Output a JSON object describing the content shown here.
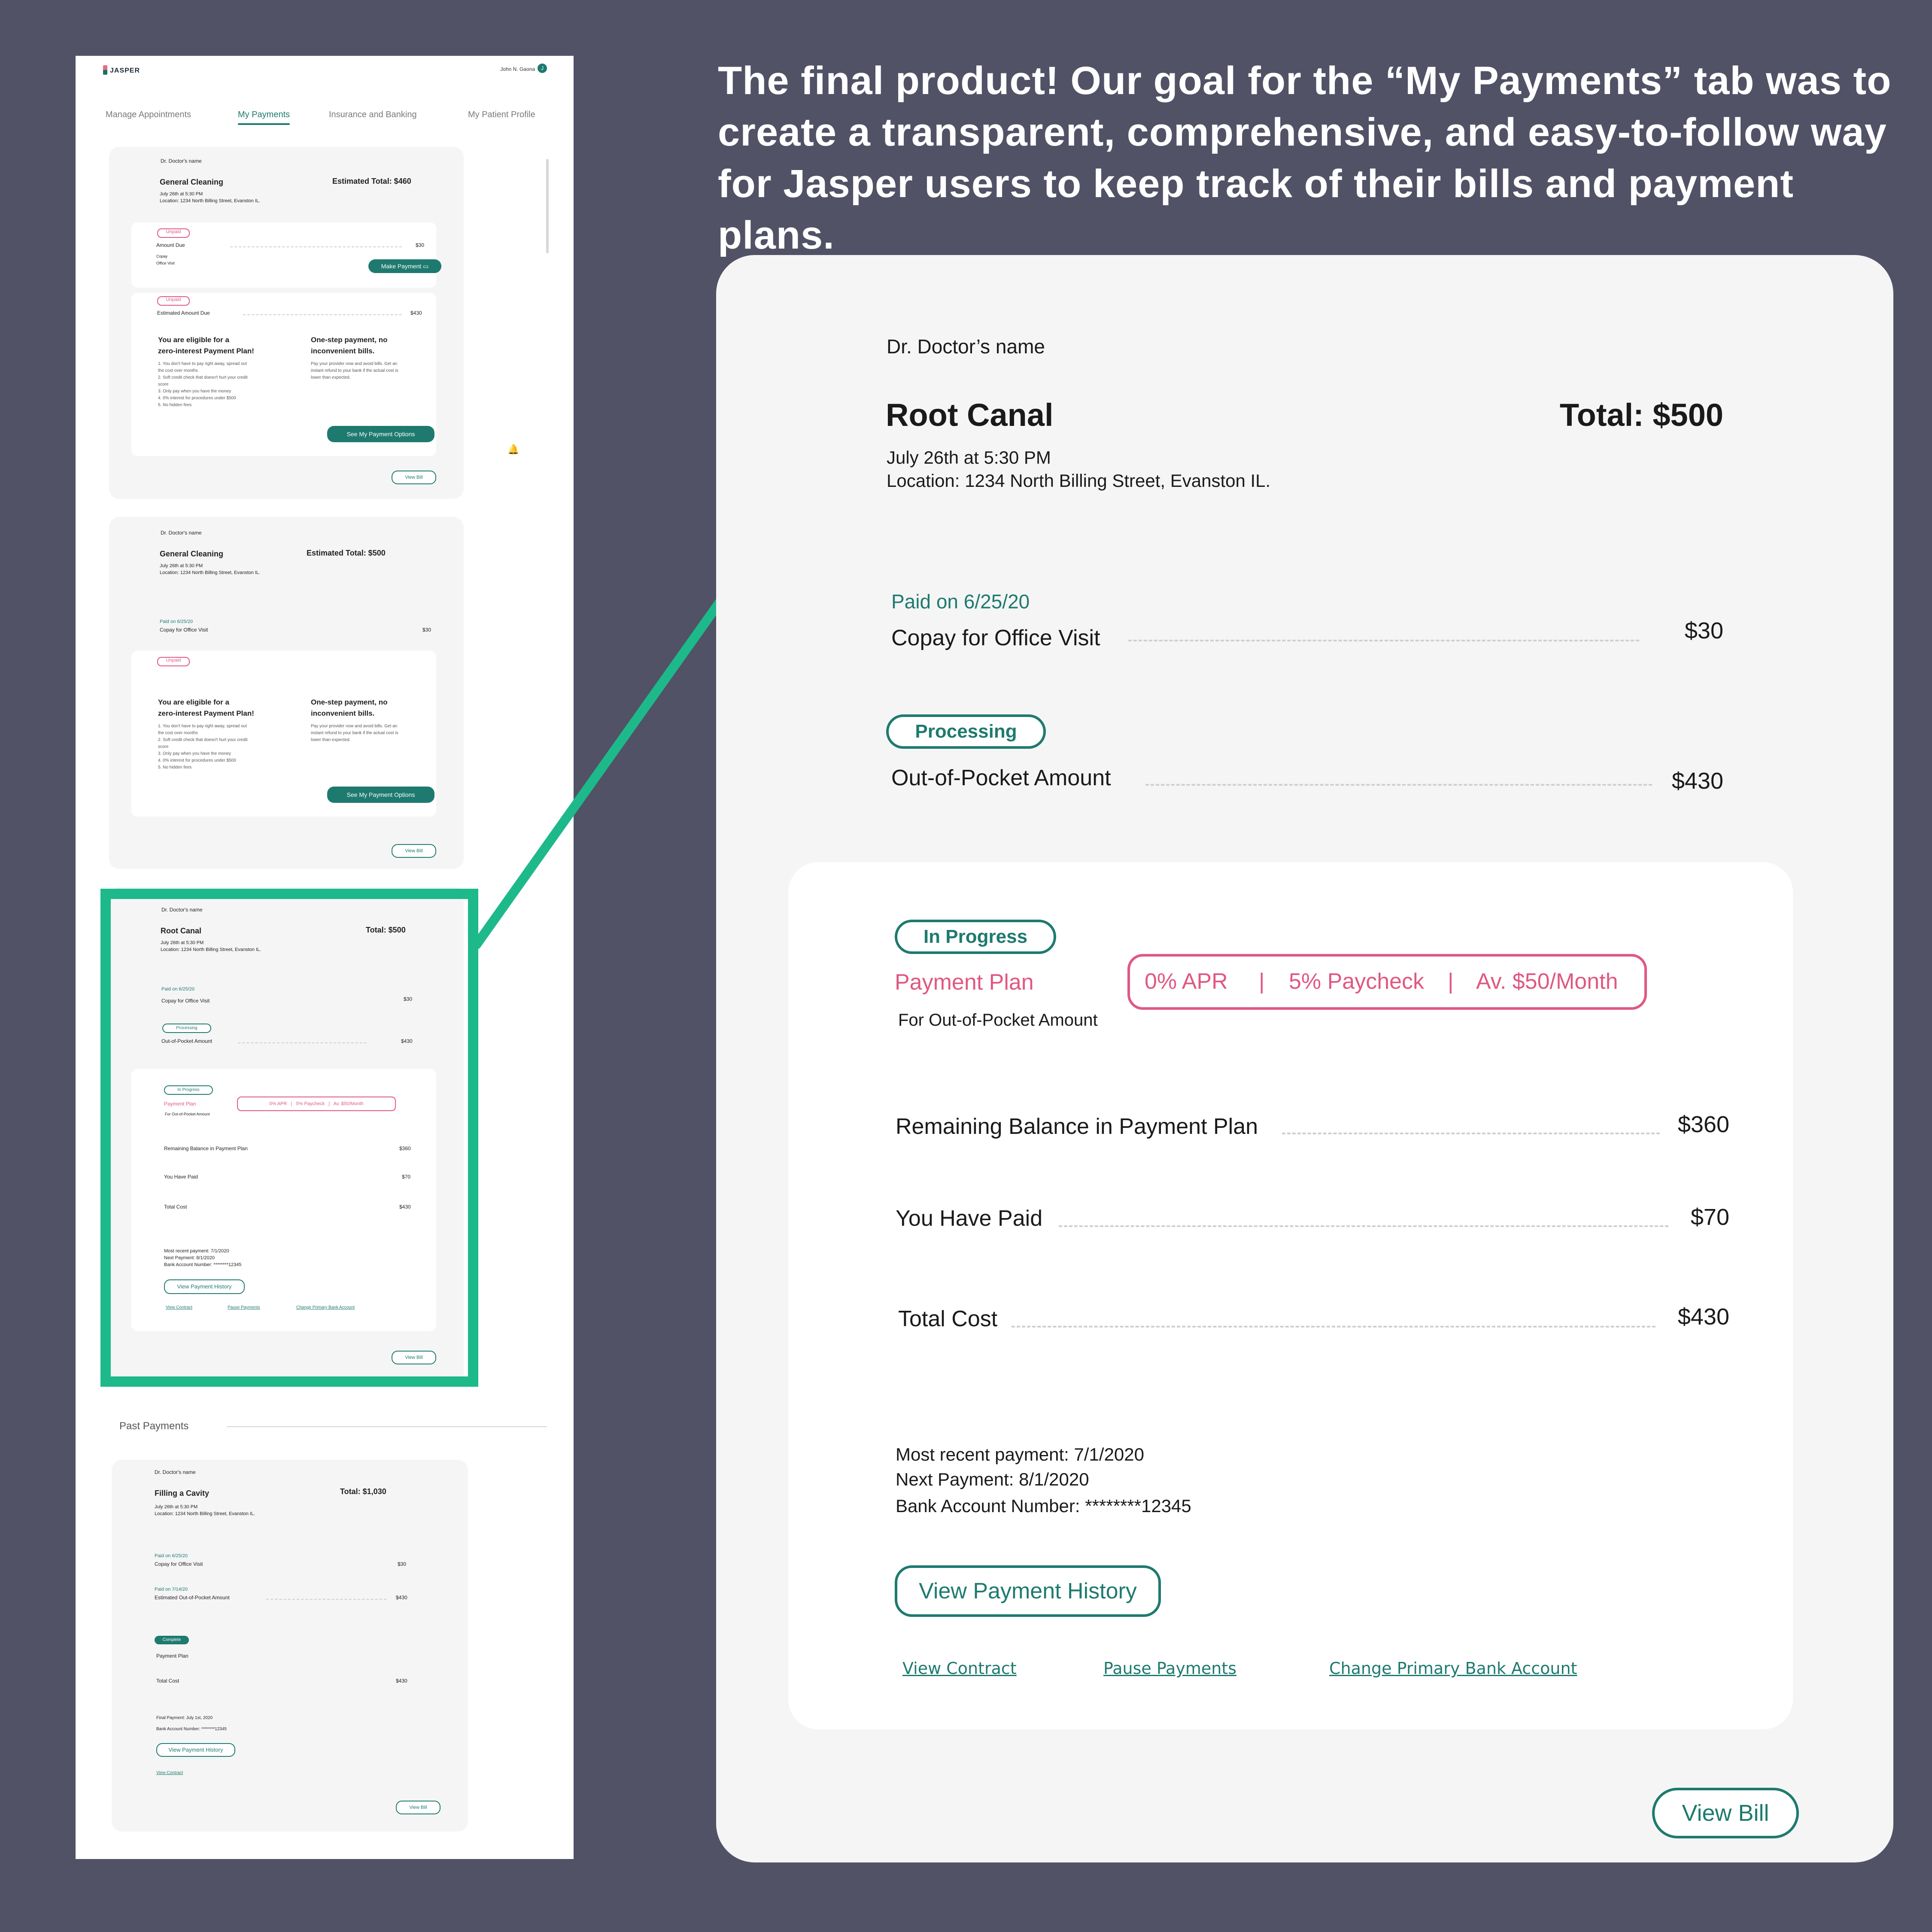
{
  "app": {
    "logo": "JASPER",
    "user_name": "John N. Gaona",
    "user_badge": "J",
    "tabs": [
      {
        "label": "Manage Appointments",
        "active": false
      },
      {
        "label": "My Payments",
        "active": true
      },
      {
        "label": "Insurance and Banking",
        "active": false
      },
      {
        "label": "My Patient Profile",
        "active": false
      }
    ]
  },
  "colors": {
    "background": "#515266",
    "brand_teal": "#1e7a6f",
    "highlight_green": "#1db98b",
    "pink": "#e05882",
    "card": "#f5f5f5"
  },
  "mini_cards": [
    {
      "doctor": "Dr. Doctor's name",
      "procedure": "General Cleaning",
      "total": "Estimated Total: $460",
      "date": "July 26th at 5:30 PM",
      "location": "Location: 1234 North Billing Street, Evanston IL.",
      "amount_due_status": "Unpaid",
      "amount_due_label": "Amount Due",
      "amount_due_value": "$30",
      "amount_due_sub1": "Copay",
      "amount_due_sub2": "Office Visit",
      "make_payment": "Make Payment",
      "est_status": "Unpaid",
      "est_label": "Estimated Amount Due",
      "est_value": "$430",
      "eligible_title_1": "You are eligible for a",
      "eligible_title_2": "zero-interest Payment Plan!",
      "eligible_points": [
        "1. You don't have to pay right away, spread out",
        "the cost over months",
        "2. Soft credit check that doesn't hurt your credit",
        "score",
        "3. Only pay when you have the money",
        "4. 0% interest for procedures under $500",
        "5. No hidden fees"
      ],
      "onestep_title_1": "One-step payment, no",
      "onestep_title_2": "inconvenient bills.",
      "onestep_body": [
        "Pay your provider now and avoid bills. Get an",
        "instant refund to your bank if the actual cost is",
        "lower than expected."
      ],
      "options_button": "See My Payment Options",
      "view_bill": "View Bill"
    },
    {
      "doctor": "Dr. Doctor's name",
      "procedure": "General Cleaning",
      "total": "Estimated Total: $500",
      "date": "July 26th at 5:30 PM",
      "location": "Location: 1234 North Billing Street, Evanston IL.",
      "paid_on": "Paid on 6/25/20",
      "copay_label": "Copay for Office Visit",
      "copay_value": "$30",
      "est_status": "Unpaid",
      "options_button": "See My Payment Options",
      "view_bill": "View Bill"
    },
    {
      "doctor": "Dr. Doctor's name",
      "procedure": "Root Canal",
      "total": "Total: $500",
      "date": "July 26th at 5:30 PM",
      "location": "Location: 1234 North Billing Street, Evanston IL.",
      "paid_on": "Paid on 6/25/20",
      "copay_label": "Copay for Office Visit",
      "copay_value": "$30",
      "processing": "Processing",
      "oop_label": "Out-of-Pocket Amount",
      "oop_value": "$430",
      "in_progress": "In Progress",
      "plan_label": "Payment Plan",
      "plan_terms": "0% APR   |   5% Paycheck   |   Av. $50/Month",
      "plan_for": "For Out-of-Pocket Amount",
      "remaining_label": "Remaining Balance in Payment Plan",
      "remaining_value": "$360",
      "paid_label": "You Have Paid",
      "paid_value": "$70",
      "cost_label": "Total Cost",
      "cost_value": "$430",
      "recent": "Most recent payment: 7/1/2020",
      "next": "Next Payment: 8/1/2020",
      "bank": "Bank Account Number: ********12345",
      "history": "View Payment History",
      "link1": "View Contract",
      "link2": "Pause Payments",
      "link3": "Change Primary Bank Account",
      "view_bill": "View Bill"
    }
  ],
  "past_payments": {
    "heading": "Past Payments",
    "doctor": "Dr. Doctor's name",
    "procedure": "Filling a Cavity",
    "total": "Total: $1,030",
    "date": "July 26th at 5:30 PM",
    "location": "Location: 1234 North Billing Street, Evanston IL.",
    "paid_on_1": "Paid on 6/25/20",
    "copay_label": "Copay for Office Visit",
    "copay_value": "$30",
    "paid_on_2": "Paid on 7/14/20",
    "est_label": "Estimated Out-of-Pocket Amount",
    "est_value": "$430",
    "complete": "Complete",
    "plan_label": "Payment Plan",
    "cost_label": "Total Cost",
    "cost_value": "$430",
    "final_payment": "Final Payment: July 1st, 2020",
    "bank": "Bank Account Number: ********12345",
    "history": "View Payment History",
    "contract": "View Contract",
    "view_bill": "View Bill"
  },
  "caption": "The final product!  Our goal for the “My Payments” tab was to create a transparent, comprehensive, and easy-to-follow way for Jasper users to keep track of their bills and payment plans.",
  "zoom": {
    "doctor": "Dr. Doctor’s name",
    "procedure": "Root Canal",
    "total": "Total: $500",
    "date": "July 26th at 5:30 PM",
    "location": "Location: 1234 North Billing Street, Evanston IL.",
    "paid_on": "Paid on 6/25/20",
    "copay_label": "Copay for Office Visit",
    "copay_value": "$30",
    "processing": "Processing",
    "oop_label": "Out-of-Pocket Amount",
    "oop_value": "$430",
    "in_progress": "In Progress",
    "plan_label": "Payment Plan",
    "plan_apr": "0% APR",
    "plan_paycheck": "5% Paycheck",
    "plan_month": "Av. $50/Month",
    "plan_sep": "|",
    "plan_for": "For Out-of-Pocket Amount",
    "remaining_label": "Remaining Balance in Payment Plan",
    "remaining_value": "$360",
    "paid_label": "You Have Paid",
    "paid_value": "$70",
    "cost_label": "Total Cost",
    "cost_value": "$430",
    "recent": "Most recent payment: 7/1/2020",
    "next": "Next Payment: 8/1/2020",
    "bank": "Bank Account Number: ********12345",
    "history": "View Payment History",
    "link_contract": "View Contract",
    "link_pause": "Pause Payments",
    "link_bank": "Change Primary Bank Account",
    "view_bill": "View Bill"
  }
}
